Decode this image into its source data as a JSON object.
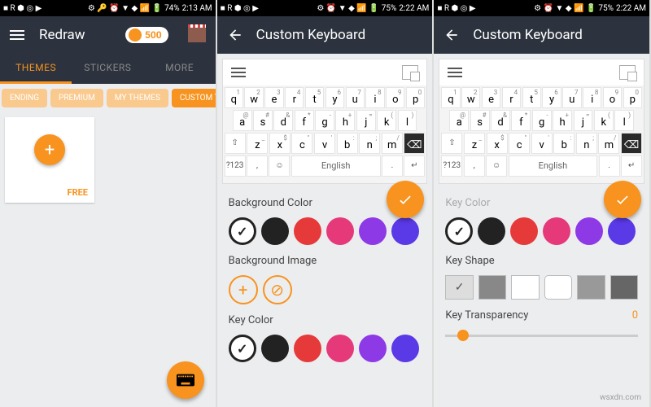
{
  "status": {
    "battery1": "74%",
    "time1": "2:13 AM",
    "battery2": "75%",
    "time2": "2:22 AM",
    "battery3": "75%",
    "time3": "2:22 AM"
  },
  "panel1": {
    "title": "Redraw",
    "coins": "500",
    "tabs": [
      "THEMES",
      "STICKERS",
      "MORE"
    ],
    "active_tab": 0,
    "chips": [
      "ENDING",
      "PREMIUM",
      "MY THEMES",
      "CUSTOM THEMES"
    ],
    "active_chip": 3,
    "card_label": "FREE"
  },
  "panel2": {
    "title": "Custom Keyboard",
    "rows": {
      "r1": [
        [
          "q",
          "1"
        ],
        [
          "w",
          "2"
        ],
        [
          "e",
          "3"
        ],
        [
          "r",
          "4"
        ],
        [
          "t",
          "5"
        ],
        [
          "y",
          "6"
        ],
        [
          "u",
          "7"
        ],
        [
          "i",
          "8"
        ],
        [
          "o",
          "9"
        ],
        [
          "p",
          "0"
        ]
      ],
      "r2": [
        [
          "a",
          "@"
        ],
        [
          "s",
          "#"
        ],
        [
          "d",
          "&"
        ],
        [
          "f",
          "*"
        ],
        [
          "g",
          "-"
        ],
        [
          "h",
          "+"
        ],
        [
          "j",
          "="
        ],
        [
          "k",
          "("
        ],
        [
          "l",
          ")"
        ]
      ],
      "r3": [
        [
          "z",
          "_"
        ],
        [
          "x",
          "$"
        ],
        [
          "c",
          "\""
        ],
        [
          "v",
          "'"
        ],
        [
          "b",
          ":"
        ],
        [
          "n",
          ";"
        ],
        [
          "m",
          "/"
        ]
      ],
      "fn": "?123",
      "space": "English"
    },
    "sec_bg": "Background Color",
    "sec_bi": "Background Image",
    "sec_kc": "Key Color",
    "colors": [
      "#222222",
      "#e63939",
      "#e6397a",
      "#c239e6",
      "#6a39e6",
      "#3951e6"
    ]
  },
  "panel3": {
    "title": "Custom Keyboard",
    "sec_kc": "Key Color",
    "sec_ks": "Key Shape",
    "sec_kt": "Key Transparency",
    "transparency": "0",
    "colors": [
      "#222222",
      "#e63939",
      "#e6397a",
      "#c239e6",
      "#6a39e6",
      "#3951e6"
    ]
  },
  "watermark": "wsxdn.com"
}
